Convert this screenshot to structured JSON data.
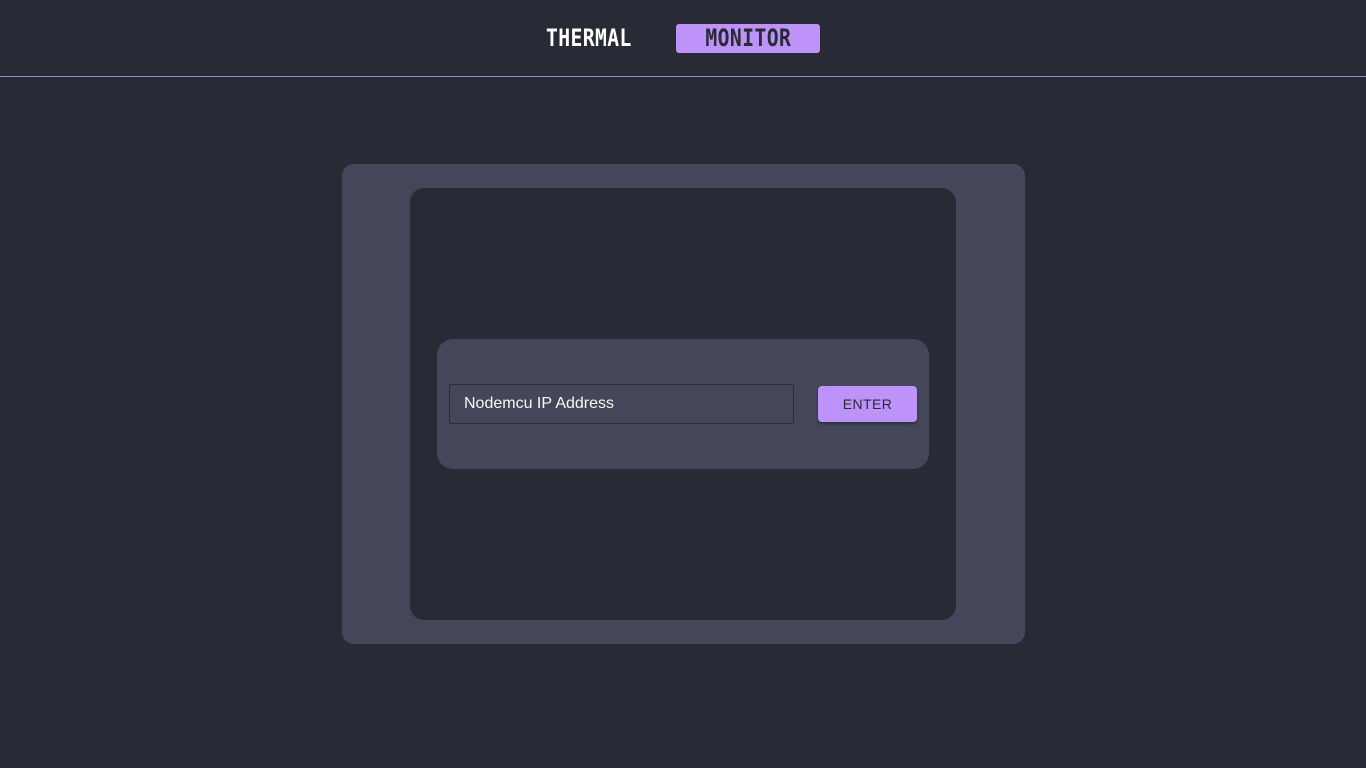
{
  "header": {
    "logo_first": "THERMAL",
    "logo_badge": "MONITOR"
  },
  "connect_form": {
    "ip_input": {
      "placeholder": "Nodemcu IP Address",
      "value": ""
    },
    "enter_label": "ENTER"
  },
  "colors": {
    "background": "#282a36",
    "panel": "#44475a",
    "accent": "#bd93f9",
    "text": "#f8f8f2"
  }
}
